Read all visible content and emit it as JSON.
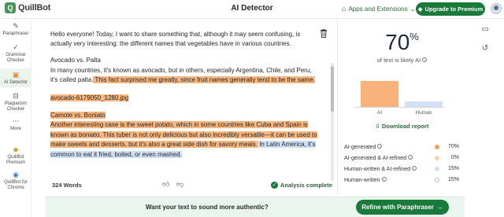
{
  "topbar": {
    "logo_text": "QuillBot",
    "title": "AI Detector",
    "apps_link": "Apps and Extensions",
    "upgrade_label": "Upgrade to Premium"
  },
  "sidebar": {
    "items": [
      {
        "label": "Paraphraser",
        "icon": "paraphraser-icon"
      },
      {
        "label": "Grammar Checker",
        "icon": "grammar-icon"
      },
      {
        "label": "AI Detector",
        "icon": "ai-detector-icon"
      },
      {
        "label": "Plagiarism Checker",
        "icon": "plagiarism-icon"
      },
      {
        "label": "More",
        "icon": "more-icon"
      },
      {
        "label": "QuillBot Premium",
        "icon": "premium-icon"
      },
      {
        "label": "QuillBot for Chrome",
        "icon": "chrome-icon"
      }
    ]
  },
  "editor": {
    "intro": "Hello everyone! Today, I want to share something that, although it may seem confusing, is actually very interesting: the different names that vegetables have in various countries.",
    "heading1": "Avocado vs. Palta",
    "para1_plain": "In many countries, it's known as avocado, but in others, especially Argentina, Chile, and Peru, it's called palta.",
    "para1_ai": " This fact surprised me greatly, since fruit names generally tend to be the same.",
    "image_ref": "avocado-6179050_1280.jpg",
    "heading2": "Camote vs. Boniato",
    "para2_ai": "Another interesting case is the sweet potato, which in some countries like Cuba and Spain is known as boniato. This tuber is not only delicious but also incredibly versatile—it can be used to make sweets and desserts, but it's also a great side dish for savory meals.",
    "para2_refined": " In Latin America, it's common to eat it fried, boiled, or even mashed.",
    "word_count": "324 Words",
    "status": "Analysis complete"
  },
  "results": {
    "percent": "70",
    "percent_sign": "%",
    "label": "of text is likely AI",
    "chart_data": {
      "type": "bar",
      "categories": [
        "AI",
        "Human"
      ],
      "values": [
        70,
        15
      ],
      "colors": [
        "#f8b27a",
        "#d2e1f5"
      ]
    },
    "download_label": "Download report",
    "rows": [
      {
        "label": "AI-generated",
        "value": "70%",
        "color": "#f0a45b"
      },
      {
        "label": "AI-generated & AI-refined",
        "value": "0%",
        "color": "#f6d3ae"
      },
      {
        "label": "Human-written & AI-refined",
        "value": "15%",
        "color": "#cfdff6"
      },
      {
        "label": "Human-written",
        "value": "15%",
        "color": "#ffffff"
      }
    ]
  },
  "banner": {
    "text": "Want your text to sound more authentic?",
    "button_label": "Refine with Paraphraser"
  },
  "colors": {
    "brand": "#1a7a3c",
    "ai_highlight": "#f8b880",
    "refined_highlight": "#cfe0f7"
  }
}
